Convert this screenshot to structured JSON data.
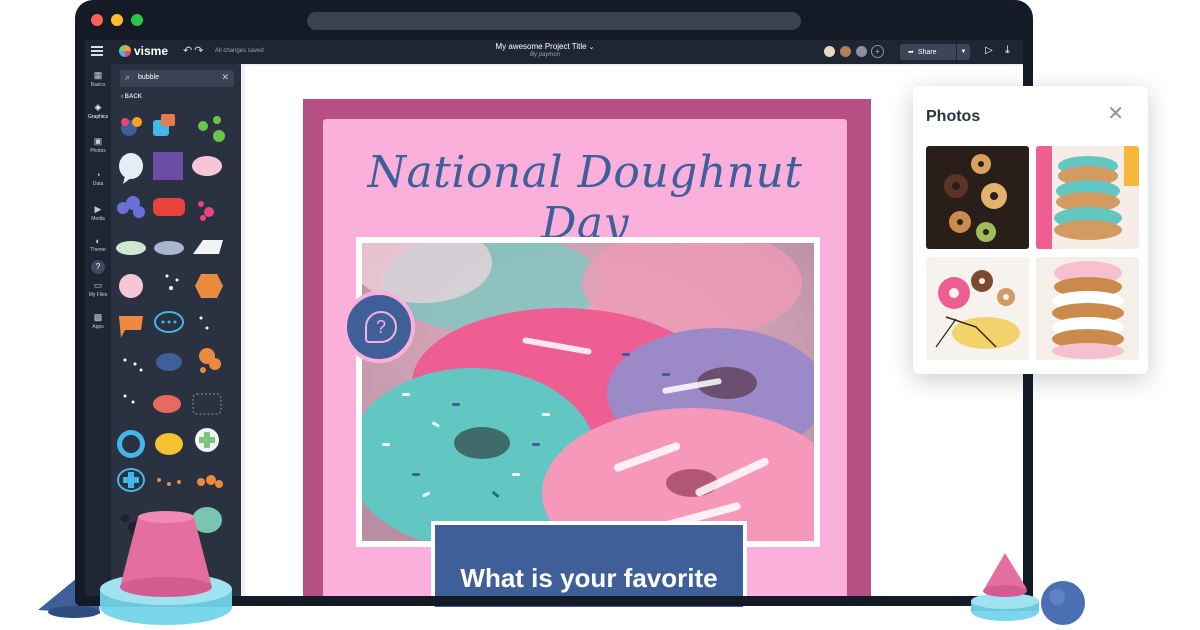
{
  "app": {
    "brand": "visme",
    "saved_status": "All changes saved",
    "project_title": "My awesome Project Title",
    "byline": "By paymon",
    "share_label": "Share"
  },
  "rail": {
    "items": [
      {
        "label": "Basics",
        "icon": "basics-icon"
      },
      {
        "label": "Graphics",
        "icon": "graphics-icon"
      },
      {
        "label": "Photos",
        "icon": "photos-icon"
      },
      {
        "label": "Data",
        "icon": "data-icon"
      },
      {
        "label": "Media",
        "icon": "media-icon"
      },
      {
        "label": "Theme",
        "icon": "theme-icon"
      },
      {
        "label": "My Files",
        "icon": "my-files-icon"
      },
      {
        "label": "Apps",
        "icon": "apps-icon"
      }
    ],
    "help": "?"
  },
  "panel": {
    "search_value": "bubble",
    "back_label": "BACK"
  },
  "poster": {
    "title": "National Doughnut Day",
    "question": "What is your favorite",
    "callout_symbol": "?"
  },
  "photos_popup": {
    "title": "Photos"
  },
  "colors": {
    "poster_border": "#b54f84",
    "poster_bg": "#fbb0dc",
    "accent_blue": "#3e5f98",
    "chrome_dark": "#1f2633"
  }
}
